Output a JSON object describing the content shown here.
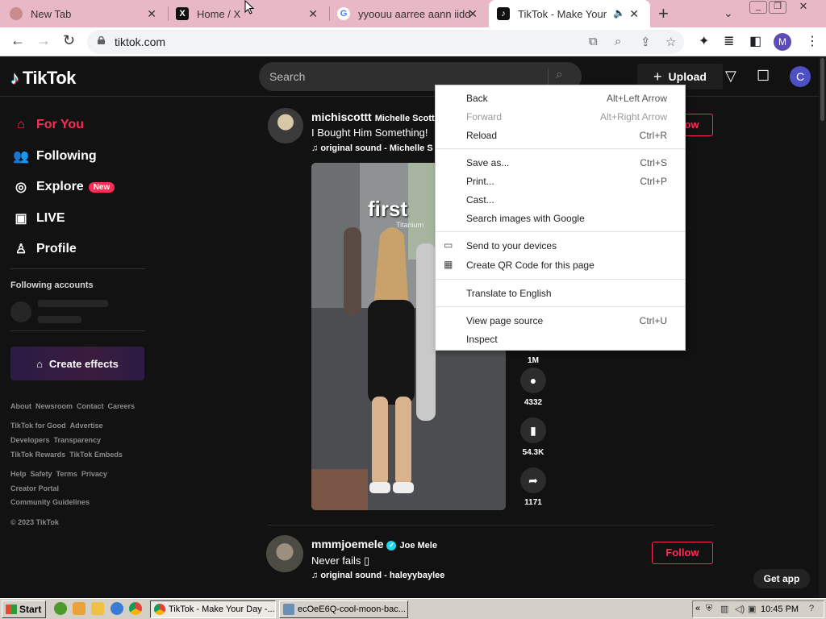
{
  "browser": {
    "tabs": [
      {
        "title": "New Tab",
        "favicon": "new-tab-icon"
      },
      {
        "title": "Home / X",
        "favicon": "x-logo-icon"
      },
      {
        "title": "yyoouu aarree aann iidd",
        "favicon": "google-icon"
      },
      {
        "title": "TikTok - Make Your D",
        "favicon": "tiktok-icon",
        "active": true
      }
    ],
    "url": "tiktok.com",
    "profile_initial": "M"
  },
  "tiktok": {
    "search_placeholder": "Search",
    "upload_label": "Upload",
    "avatar_initial": "C",
    "nav": [
      {
        "label": "For You",
        "icon": "home-icon",
        "active": true
      },
      {
        "label": "Following",
        "icon": "people-icon"
      },
      {
        "label": "Explore",
        "icon": "compass-icon",
        "badge": "New"
      },
      {
        "label": "LIVE",
        "icon": "live-icon"
      },
      {
        "label": "Profile",
        "icon": "person-icon"
      }
    ],
    "following_accounts_title": "Following accounts",
    "create_effects": "Create effects",
    "footer": [
      [
        "About",
        "Newsroom",
        "Contact",
        "Careers"
      ],
      [
        "TikTok for Good",
        "Advertise"
      ],
      [
        "Developers",
        "Transparency"
      ],
      [
        "TikTok Rewards",
        "TikTok Embeds"
      ],
      [
        "Help",
        "Safety",
        "Terms",
        "Privacy"
      ],
      [
        "Creator Portal"
      ],
      [
        "Community Guidelines"
      ]
    ],
    "copyright": "© 2023 TikTok",
    "posts": [
      {
        "username": "michiscottt",
        "display_name": "Michelle Scott",
        "caption": "I Bought Him Something!",
        "sound": "original sound - Michelle S",
        "follow_label": "Follow",
        "overlay_text": "first",
        "overlay_sub": "Titanium",
        "actions": [
          {
            "icon": "heart-icon",
            "count": "1M"
          },
          {
            "icon": "comment-icon",
            "count": "4332"
          },
          {
            "icon": "bookmark-icon",
            "count": "54.3K"
          },
          {
            "icon": "share-icon",
            "count": "1171"
          }
        ]
      },
      {
        "username": "mmmjoemele",
        "display_name": "Joe Mele",
        "caption": "Never fails ▯",
        "sound": "original sound - haleyybaylee",
        "follow_label": "Follow",
        "verified": true
      }
    ],
    "get_app": "Get app"
  },
  "context_menu": {
    "items": [
      {
        "label": "Back",
        "shortcut": "Alt+Left Arrow"
      },
      {
        "label": "Forward",
        "shortcut": "Alt+Right Arrow",
        "disabled": true
      },
      {
        "label": "Reload",
        "shortcut": "Ctrl+R"
      },
      {
        "label": "Save as...",
        "shortcut": "Ctrl+S"
      },
      {
        "label": "Print...",
        "shortcut": "Ctrl+P"
      },
      {
        "label": "Cast...",
        "shortcut": ""
      },
      {
        "label": "Search images with Google",
        "shortcut": ""
      },
      {
        "label": "Send to your devices",
        "shortcut": "",
        "icon": "devices-icon"
      },
      {
        "label": "Create QR Code for this page",
        "shortcut": "",
        "icon": "qr-code-icon"
      },
      {
        "label": "Translate to English",
        "shortcut": ""
      },
      {
        "label": "View page source",
        "shortcut": "Ctrl+U"
      },
      {
        "label": "Inspect",
        "shortcut": ""
      }
    ]
  },
  "taskbar": {
    "start_label": "Start",
    "tasks": [
      {
        "label": "TikTok - Make Your Day -...",
        "active": true
      },
      {
        "label": "ecOeE6Q-cool-moon-bac...",
        "active": false
      }
    ],
    "clock": "10:45 PM"
  },
  "colors": {
    "accent": "#fe2c55",
    "tab_strip": "#e9b8c6",
    "page_bg": "#121212"
  }
}
